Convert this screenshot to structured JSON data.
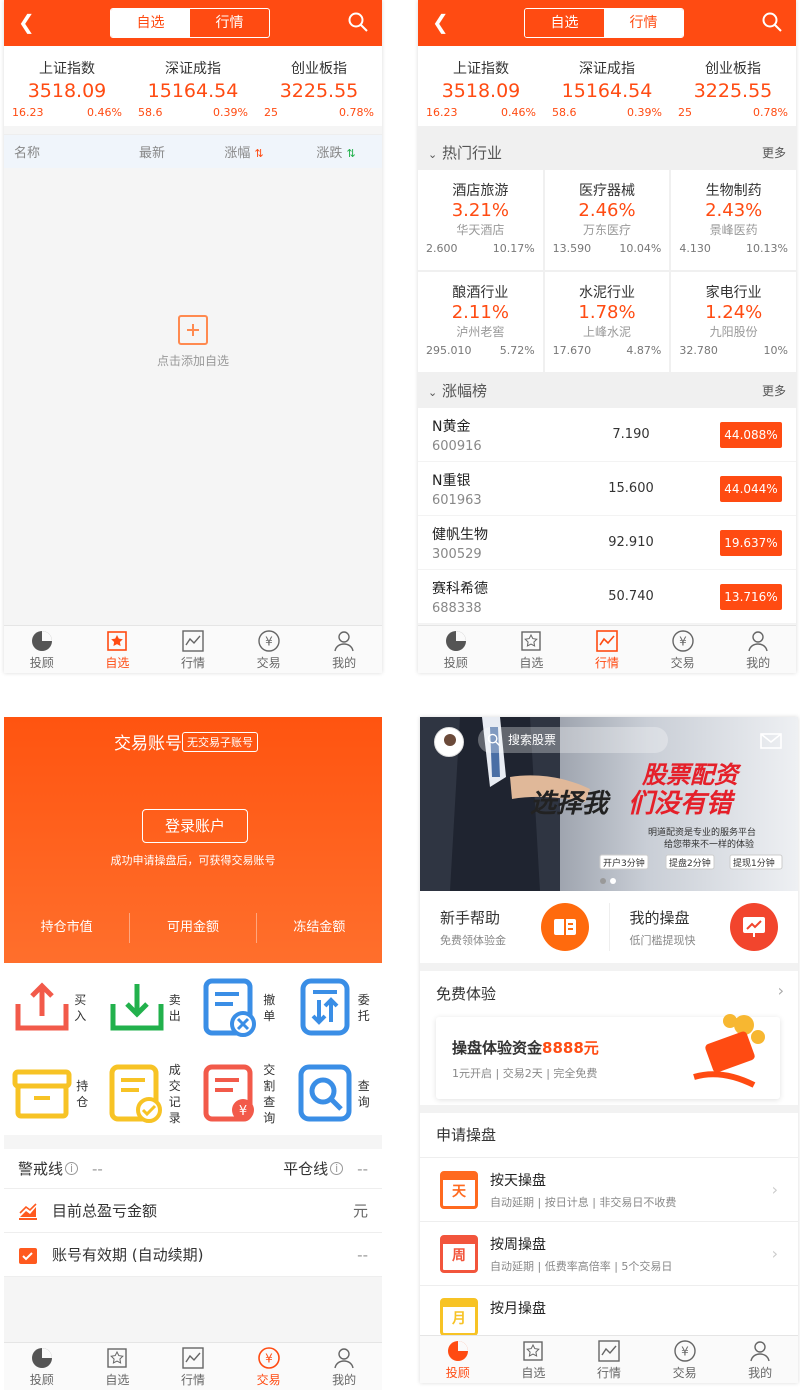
{
  "common": {
    "seg_selected": "自选",
    "seg_market": "行情",
    "indices": [
      {
        "name": "上证指数",
        "value": "3518.09",
        "change": "16.23",
        "pct": "0.46%"
      },
      {
        "name": "深证成指",
        "value": "15164.54",
        "change": "58.6",
        "pct": "0.39%"
      },
      {
        "name": "创业板指",
        "value": "3225.55",
        "change": "25",
        "pct": "0.78%"
      }
    ],
    "tabs": [
      "投顾",
      "自选",
      "行情",
      "交易",
      "我的"
    ]
  },
  "watchlist": {
    "columns": [
      "名称",
      "最新",
      "涨幅",
      "涨跌"
    ],
    "empty_hint": "点击添加自选"
  },
  "market": {
    "hot_title": "热门行业",
    "more": "更多",
    "industries": [
      {
        "name": "酒店旅游",
        "pct": "3.21%",
        "stock": "华天酒店",
        "price": "2.600",
        "spct": "10.17%"
      },
      {
        "name": "医疗器械",
        "pct": "2.46%",
        "stock": "万东医疗",
        "price": "13.590",
        "spct": "10.04%"
      },
      {
        "name": "生物制药",
        "pct": "2.43%",
        "stock": "景峰医药",
        "price": "4.130",
        "spct": "10.13%"
      },
      {
        "name": "酿酒行业",
        "pct": "2.11%",
        "stock": "泸州老窖",
        "price": "295.010",
        "spct": "5.72%"
      },
      {
        "name": "水泥行业",
        "pct": "1.78%",
        "stock": "上峰水泥",
        "price": "17.670",
        "spct": "4.87%"
      },
      {
        "name": "家电行业",
        "pct": "1.24%",
        "stock": "九阳股份",
        "price": "32.780",
        "spct": "10%"
      }
    ],
    "rank_title": "涨幅榜",
    "rank": [
      {
        "name": "N黄金",
        "code": "600916",
        "price": "7.190",
        "pct": "44.088%"
      },
      {
        "name": "N重银",
        "code": "601963",
        "price": "15.600",
        "pct": "44.044%"
      },
      {
        "name": "健帆生物",
        "code": "300529",
        "price": "92.910",
        "pct": "19.637%"
      },
      {
        "name": "赛科希德",
        "code": "688338",
        "price": "50.740",
        "pct": "13.716%"
      }
    ]
  },
  "trade": {
    "title": "交易账号",
    "no_account_tag": "无交易子账号",
    "login_button": "登录账户",
    "hint": "成功申请操盘后，可获得交易账号",
    "cols": [
      "持仓市值",
      "可用金额",
      "冻结金额"
    ],
    "functions": [
      {
        "label": "买入",
        "icon": "buy-icon",
        "color": "#f25a4a"
      },
      {
        "label": "卖出",
        "icon": "sell-icon",
        "color": "#22b14c"
      },
      {
        "label": "撤单",
        "icon": "cancel-order-icon",
        "color": "#3a8ee6"
      },
      {
        "label": "委托",
        "icon": "entrust-icon",
        "color": "#3a8ee6"
      },
      {
        "label": "持仓",
        "icon": "position-icon",
        "color": "#f7c325"
      },
      {
        "label": "成交记录",
        "icon": "deal-record-icon",
        "color": "#f7c325"
      },
      {
        "label": "交割查询",
        "icon": "delivery-query-icon",
        "color": "#f25a4a"
      },
      {
        "label": "查询",
        "icon": "query-icon",
        "color": "#3a8ee6"
      }
    ],
    "warn_label": "警戒线",
    "warn_value": "--",
    "close_label": "平仓线",
    "close_value": "--",
    "pnl_label": "目前总盈亏金额",
    "pnl_unit": "元",
    "valid_label": "账号有效期 (自动续期)",
    "valid_value": "--"
  },
  "advisor": {
    "search_placeholder": "搜索股票",
    "banner_slogan1": "选择我",
    "banner_slogan2": "股票配资",
    "banner_slogan3": "们没有错",
    "banner_sub1": "明道配资是专业的服务平台",
    "banner_sub2": "给您带来不一样的体验",
    "banner_chips": [
      "开户3分钟",
      "提盘2分钟",
      "提现1分钟"
    ],
    "quick": [
      {
        "title": "新手帮助",
        "sub": "免费领体验金"
      },
      {
        "title": "我的操盘",
        "sub": "低门槛提现快"
      }
    ],
    "free_title": "免费体验",
    "free_card_title": "操盘体验资金",
    "free_amount": "8888元",
    "free_card_sub": "1元开启 | 交易2天 | 完全免费",
    "apply_title": "申请操盘",
    "plans": [
      {
        "title": "按天操盘",
        "sub": "自动延期 | 按日计息 | 非交易日不收费",
        "icon_char": "天",
        "color": "#ff6a1f"
      },
      {
        "title": "按周操盘",
        "sub": "自动延期 | 低费率高倍率 | 5个交易日",
        "icon_char": "周",
        "color": "#f2553c"
      },
      {
        "title": "按月操盘",
        "sub": "",
        "icon_char": "月",
        "color": "#f7c325"
      }
    ]
  }
}
